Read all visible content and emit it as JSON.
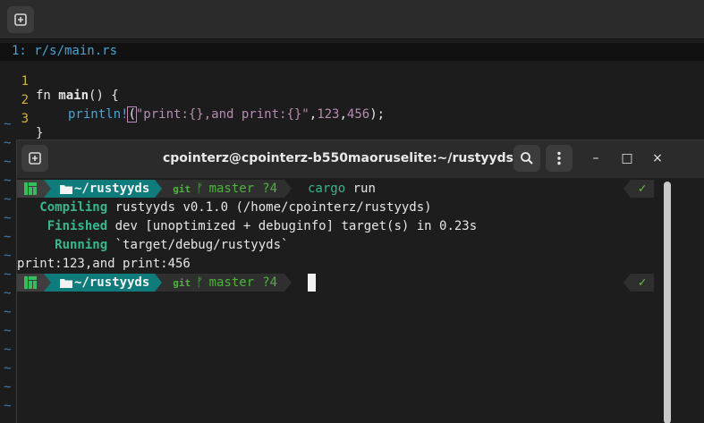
{
  "editor": {
    "tabline": "1: r/s/main.rs",
    "lines": [
      {
        "num": "1",
        "kw": "fn ",
        "name": "main",
        "rest": "() {"
      },
      {
        "num": "2",
        "macro": "println!",
        "open": "(",
        "str": "\"print:{},and print:{}\"",
        "sep1": ",",
        "n1": "123",
        "sep2": ",",
        "n2": "456",
        "close": ");"
      },
      {
        "num": "3",
        "text": "}"
      }
    ],
    "tilde": "~"
  },
  "terminal": {
    "title": "cpointerz@cpointerz-b550maoruselite:~/rustyyds",
    "controls": {
      "minimize": "–",
      "maximize": "□",
      "close": "×"
    },
    "prompt": {
      "dir": "~/rustyyds",
      "git_label": "git",
      "branch_icon": "ᚠ",
      "branch": "master",
      "dirty": "?4",
      "status": "✓"
    },
    "command": "cargo",
    "command_arg": " run",
    "output": [
      {
        "tag": "   Compiling",
        "text": " rustyyds v0.1.0 (/home/cpointerz/rustyyds)"
      },
      {
        "tag": "    Finished",
        "text": " dev [unoptimized + debuginfo] target(s) in 0.23s"
      },
      {
        "tag": "     Running",
        "text": " `target/debug/rustyyds`"
      },
      {
        "tag": "",
        "text": "print:123,and print:456"
      }
    ]
  },
  "colors": {
    "accent_teal": "#0f7b7b",
    "git_green": "#4db33d",
    "cargo_green": "#3ab68f",
    "line_number": "#d7b03c",
    "tilde_blue": "#3f7db0"
  }
}
